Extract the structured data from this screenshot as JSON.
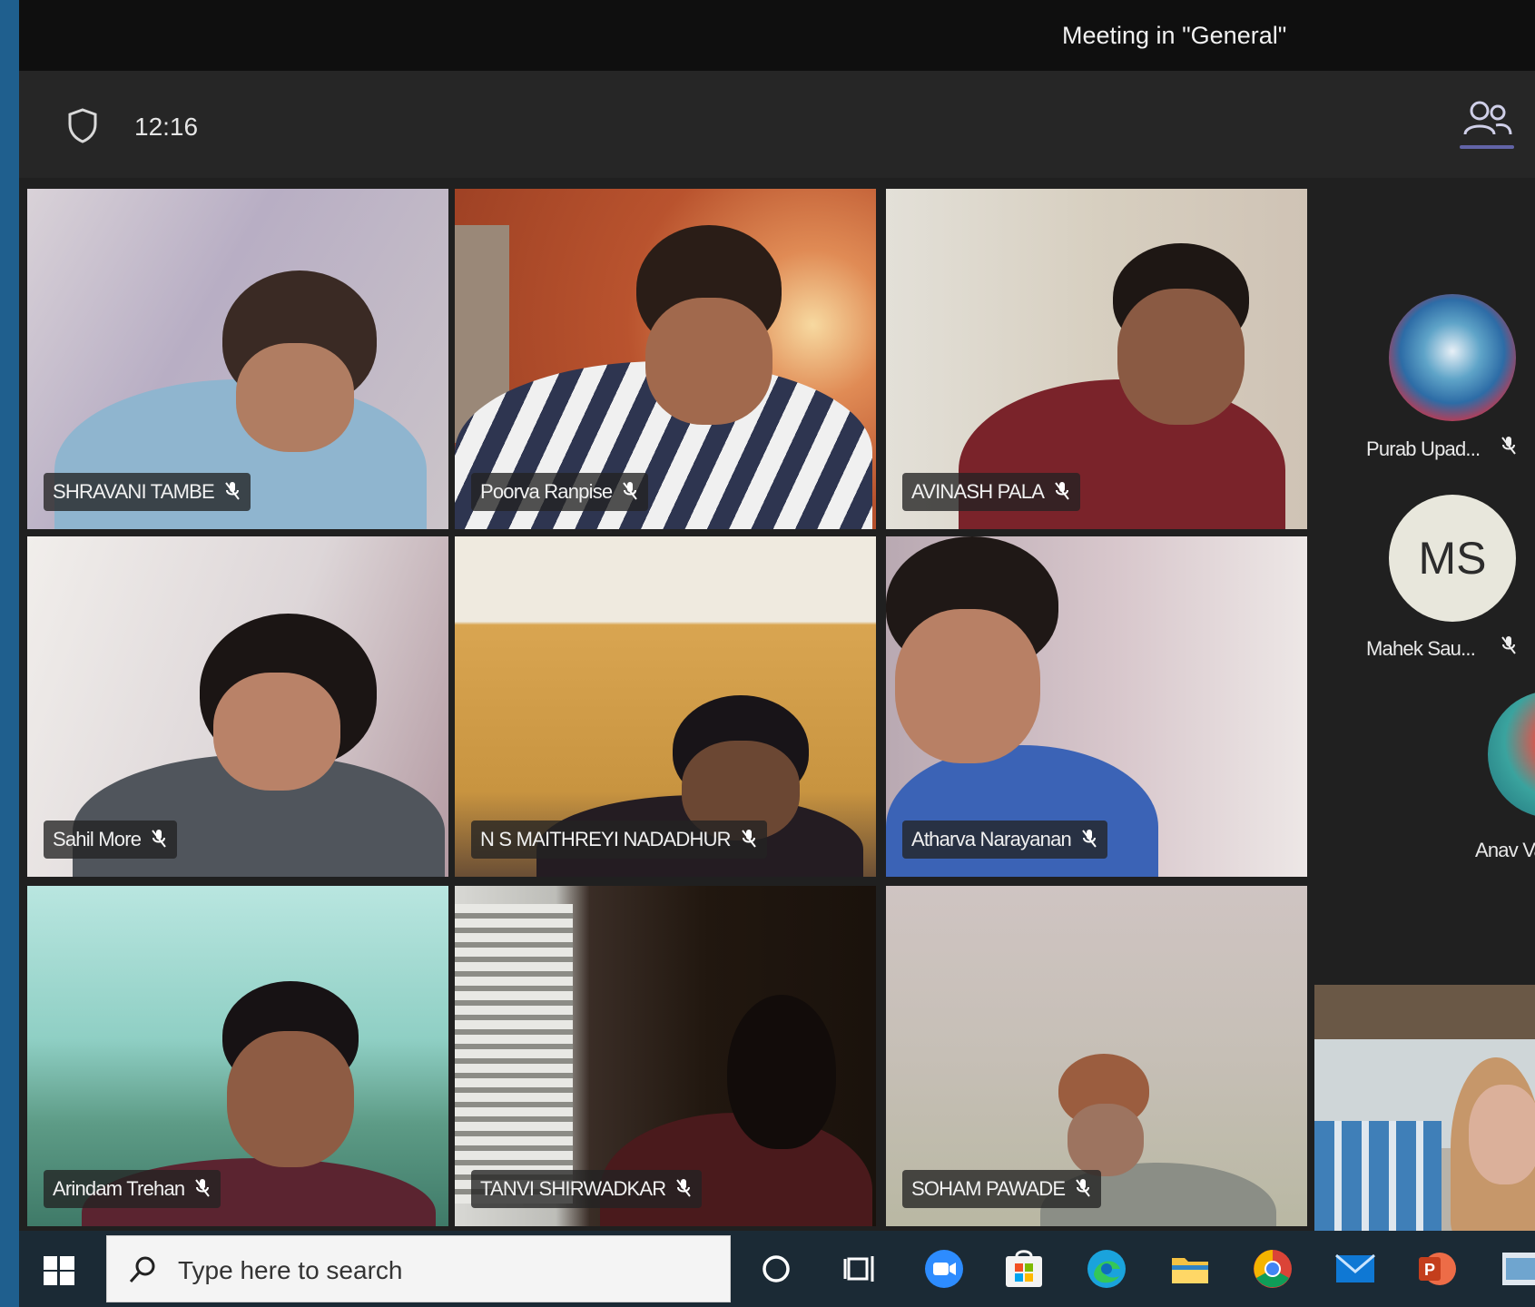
{
  "window": {
    "title": "Meeting in \"General\""
  },
  "toolbar": {
    "timer": "12:16",
    "shield_icon": "shield-icon",
    "participants_icon": "people-icon"
  },
  "tiles": [
    {
      "name": "SHRAVANI TAMBE"
    },
    {
      "name": "Poorva Ranpise"
    },
    {
      "name": "AVINASH PALA"
    },
    {
      "name": "Sahil More"
    },
    {
      "name": "N S MAITHREYI NADADHUR"
    },
    {
      "name": "Atharva Narayanan"
    },
    {
      "name": "Arindam Trehan"
    },
    {
      "name": "TANVI SHIRWADKAR"
    },
    {
      "name": "SOHAM PAWADE"
    }
  ],
  "roster": [
    {
      "name": "Purab Upad...",
      "avatar": "photo"
    },
    {
      "name": "Mahek Sau...",
      "initials": "MS"
    },
    {
      "name": "Anav Va",
      "avatar": "photo"
    }
  ],
  "taskbar": {
    "search_placeholder": "Type here to search",
    "icons": [
      "windows-start-icon",
      "cortana-icon",
      "task-view-icon",
      "zoom-icon",
      "microsoft-store-icon",
      "edge-icon",
      "file-explorer-icon",
      "chrome-icon",
      "mail-icon",
      "powerpoint-icon",
      "app-icon"
    ]
  }
}
